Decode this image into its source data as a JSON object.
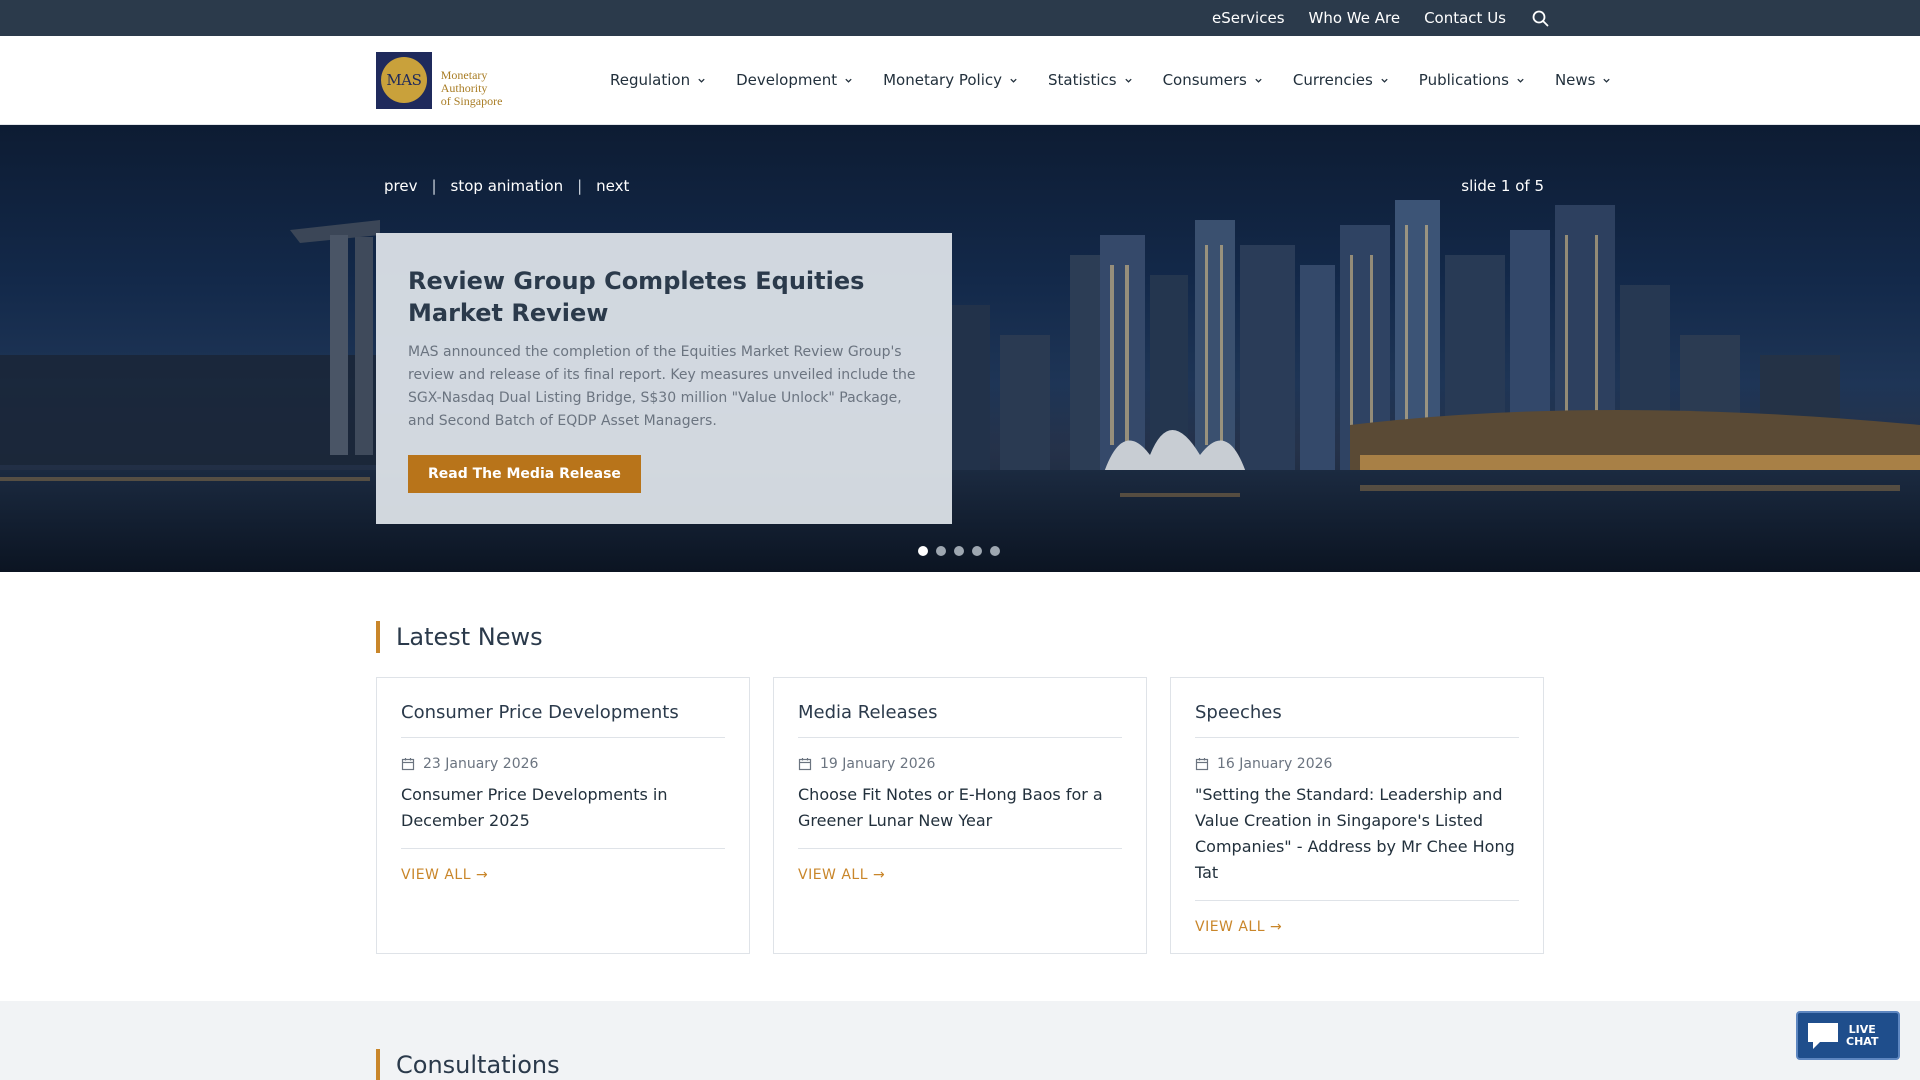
{
  "utility": {
    "links": [
      "eServices",
      "Who We Are",
      "Contact Us"
    ]
  },
  "logo": {
    "mark": "MAS",
    "line1": "Monetary Authority",
    "line2": "of Singapore"
  },
  "nav": {
    "items": [
      "Regulation",
      "Development",
      "Monetary Policy",
      "Statistics",
      "Consumers",
      "Currencies",
      "Publications",
      "News"
    ]
  },
  "hero": {
    "prev": "prev",
    "stop": "stop animation",
    "next": "next",
    "separator": "|",
    "slide_count": "slide 1 of 5",
    "title": "Review Group Completes Equities Market Review",
    "body": "MAS announced the completion of the Equities Market Review Group's review and release of its final report. Key measures unveiled include the SGX-Nasdaq Dual Listing Bridge, S$30 million \"Value Unlock\" Package, and Second Batch of EQDP Asset Managers.",
    "button": "Read The Media Release",
    "active_slide": 1,
    "total_slides": 5
  },
  "latest_news": {
    "title": "Latest News",
    "cards": [
      {
        "category": "Consumer Price Developments",
        "date": "23 January 2026",
        "headline": "Consumer Price Developments in December 2025",
        "view_all": "VIEW ALL →"
      },
      {
        "category": "Media Releases",
        "date": "19 January 2026",
        "headline": "Choose Fit Notes or E-Hong Baos for a Greener Lunar New Year",
        "view_all": "VIEW ALL →"
      },
      {
        "category": "Speeches",
        "date": "16 January 2026",
        "headline": "\"Setting the Standard: Leadership and Value Creation in Singapore's Listed Companies\" - Address by Mr Chee Hong Tat",
        "view_all": "VIEW ALL →"
      }
    ]
  },
  "consultations": {
    "title": "Consultations"
  },
  "live_chat": {
    "line1": "LIVE",
    "line2": "CHAT"
  },
  "colors": {
    "utility_bar": "#2b3a4b",
    "accent": "#c9862a",
    "button": "#b8741a",
    "logo_navy": "#1f2a5c",
    "logo_gold": "#c9a13b"
  },
  "icons": {
    "search": "search-icon",
    "chevron": "chevron-down-icon",
    "calendar": "calendar-icon",
    "chat": "chat-bubble-icon"
  }
}
